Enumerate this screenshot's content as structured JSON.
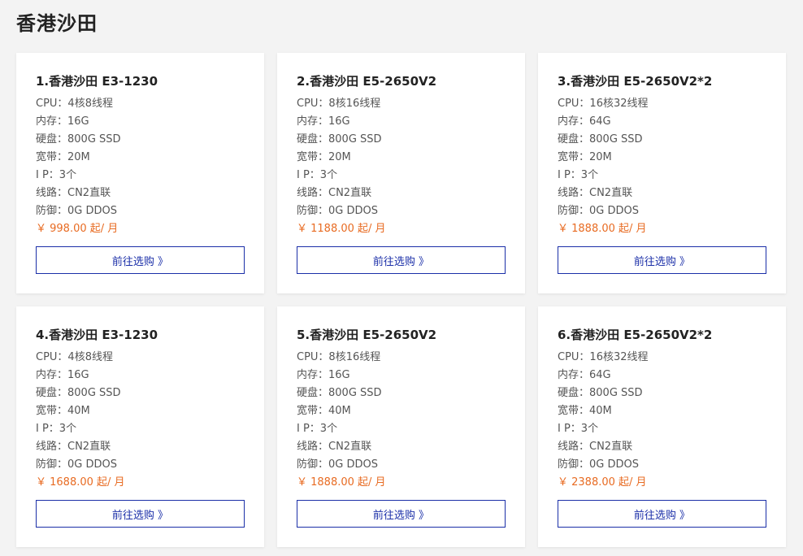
{
  "page_title": "香港沙田",
  "buy_label": "前往选购 》",
  "accent_color": "#1b2fa8",
  "price_color": "#e86b22",
  "cards": [
    {
      "title": "1.香港沙田 E3-1230",
      "cpu": "CPU：4核8线程",
      "ram": "内存：16G",
      "disk": "硬盘：800G SSD",
      "bandwidth": "宽带：20M",
      "ip": "I P：3个",
      "line": "线路：CN2直联",
      "defense": "防御：0G DDOS",
      "price": "￥ 998.00 起/ 月"
    },
    {
      "title": "2.香港沙田 E5-2650V2",
      "cpu": "CPU：8核16线程",
      "ram": "内存：16G",
      "disk": "硬盘：800G SSD",
      "bandwidth": "宽带：20M",
      "ip": "I P：3个",
      "line": "线路：CN2直联",
      "defense": "防御：0G DDOS",
      "price": "￥ 1188.00 起/ 月"
    },
    {
      "title": "3.香港沙田 E5-2650V2*2",
      "cpu": "CPU：16核32线程",
      "ram": "内存：64G",
      "disk": "硬盘：800G SSD",
      "bandwidth": "宽带：20M",
      "ip": "I P：3个",
      "line": "线路：CN2直联",
      "defense": "防御：0G DDOS",
      "price": "￥ 1888.00 起/ 月"
    },
    {
      "title": "4.香港沙田 E3-1230",
      "cpu": "CPU：4核8线程",
      "ram": "内存：16G",
      "disk": "硬盘：800G SSD",
      "bandwidth": "宽带：40M",
      "ip": "I P：3个",
      "line": "线路：CN2直联",
      "defense": "防御：0G DDOS",
      "price": "￥ 1688.00 起/ 月"
    },
    {
      "title": "5.香港沙田 E5-2650V2",
      "cpu": "CPU：8核16线程",
      "ram": "内存：16G",
      "disk": "硬盘：800G SSD",
      "bandwidth": "宽带：40M",
      "ip": "I P：3个",
      "line": "线路：CN2直联",
      "defense": "防御：0G DDOS",
      "price": "￥ 1888.00 起/ 月"
    },
    {
      "title": "6.香港沙田 E5-2650V2*2",
      "cpu": "CPU：16核32线程",
      "ram": "内存：64G",
      "disk": "硬盘：800G SSD",
      "bandwidth": "宽带：40M",
      "ip": "I P：3个",
      "line": "线路：CN2直联",
      "defense": "防御：0G DDOS",
      "price": "￥ 2388.00 起/ 月"
    }
  ]
}
